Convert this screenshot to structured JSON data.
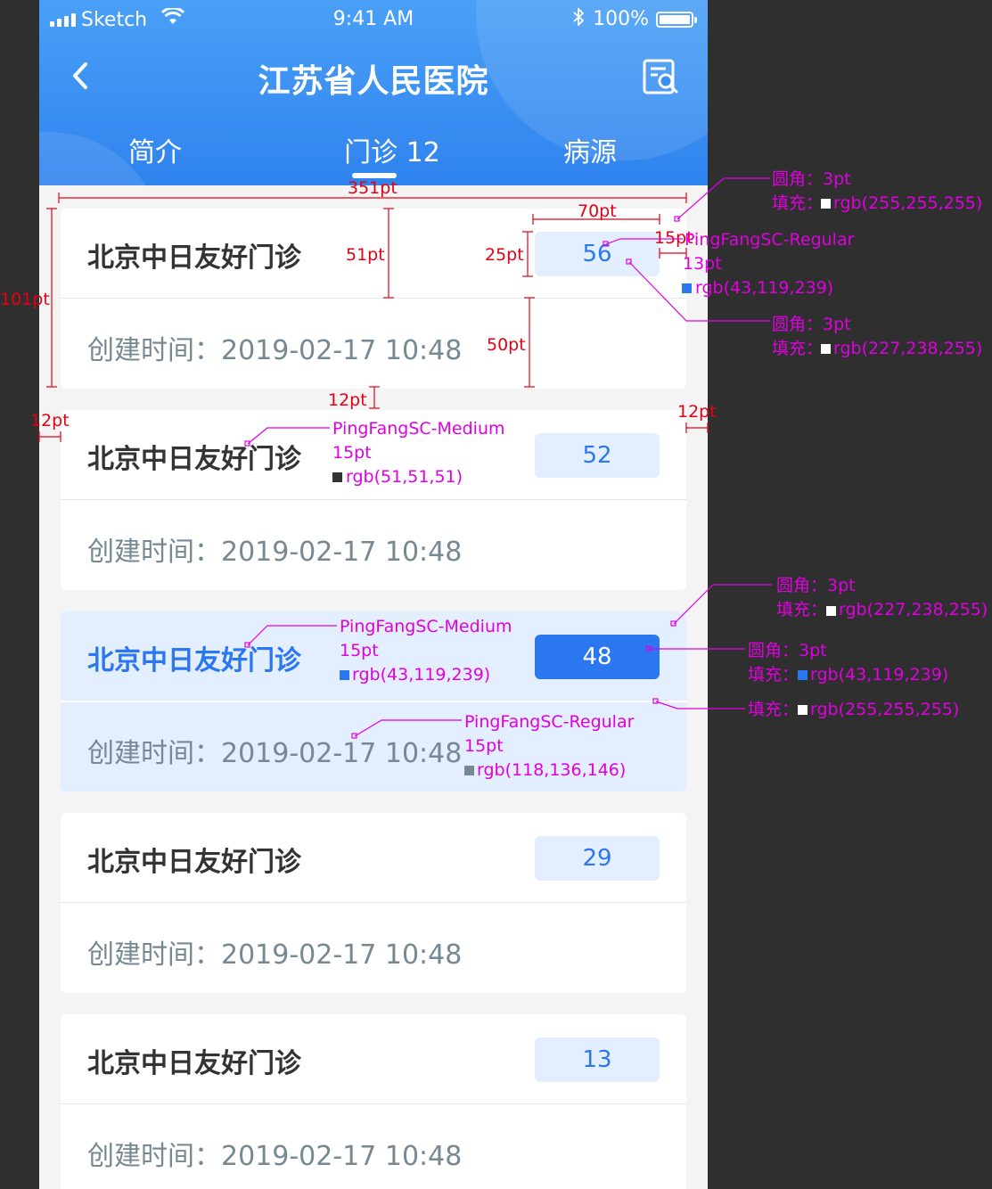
{
  "status_bar": {
    "carrier": "Sketch",
    "time": "9:41 AM",
    "battery": "100%"
  },
  "header": {
    "title": "江苏省人民医院"
  },
  "tabs": [
    {
      "label": "简介"
    },
    {
      "label": "门诊 12"
    },
    {
      "label": "病源"
    }
  ],
  "clinics": [
    {
      "name": "北京中日友好门诊",
      "count": "56",
      "created": "创建时间：2019-02-17 10:48"
    },
    {
      "name": "北京中日友好门诊",
      "count": "52",
      "created": "创建时间：2019-02-17 10:48"
    },
    {
      "name": "北京中日友好门诊",
      "count": "48",
      "created": "创建时间：2019-02-17 10:48",
      "selected": true
    },
    {
      "name": "北京中日友好门诊",
      "count": "29",
      "created": "创建时间：2019-02-17 10:48"
    },
    {
      "name": "北京中日友好门诊",
      "count": "13",
      "created": "创建时间：2019-02-17 10:48"
    }
  ],
  "annotations": {
    "width_351": "351pt",
    "w70": "70pt",
    "h51": "51pt",
    "h25": "25pt",
    "h50": "50pt",
    "h101": "101pt",
    "gap12_mid": "12pt",
    "gap12_left": "12pt",
    "gap12_right": "12pt",
    "pad15": "15pt",
    "card_radius_label": "圆角：3pt",
    "card_fill_label": "填充：",
    "card_fill_value": "rgb(255,255,255)",
    "count_font": "PingFangSC-Regular",
    "count_size": "13pt",
    "count_color": "rgb(43,119,239)",
    "count_radius_label": "圆角：3pt",
    "count_fill_label": "填充：",
    "count_fill_value": "rgb(227,238,255)",
    "name_font": "PingFangSC-Medium",
    "name_size": "15pt",
    "name_color": "rgb(51,51,51)",
    "sel_radius_label": "圆角：3pt",
    "sel_fill_label": "填充：",
    "sel_fill_value": "rgb(227,238,255)",
    "sel_name_font": "PingFangSC-Medium",
    "sel_name_size": "15pt",
    "sel_name_color": "rgb(43,119,239)",
    "sel_count_radius_label": "圆角：3pt",
    "sel_count_fill_label": "填充：",
    "sel_count_fill_value": "rgb(43,119,239)",
    "divider_fill_label": "填充：",
    "divider_fill_value": "rgb(255,255,255)",
    "time_font": "PingFangSC-Regular",
    "time_size": "15pt",
    "time_color": "rgb(118,136,146)"
  }
}
